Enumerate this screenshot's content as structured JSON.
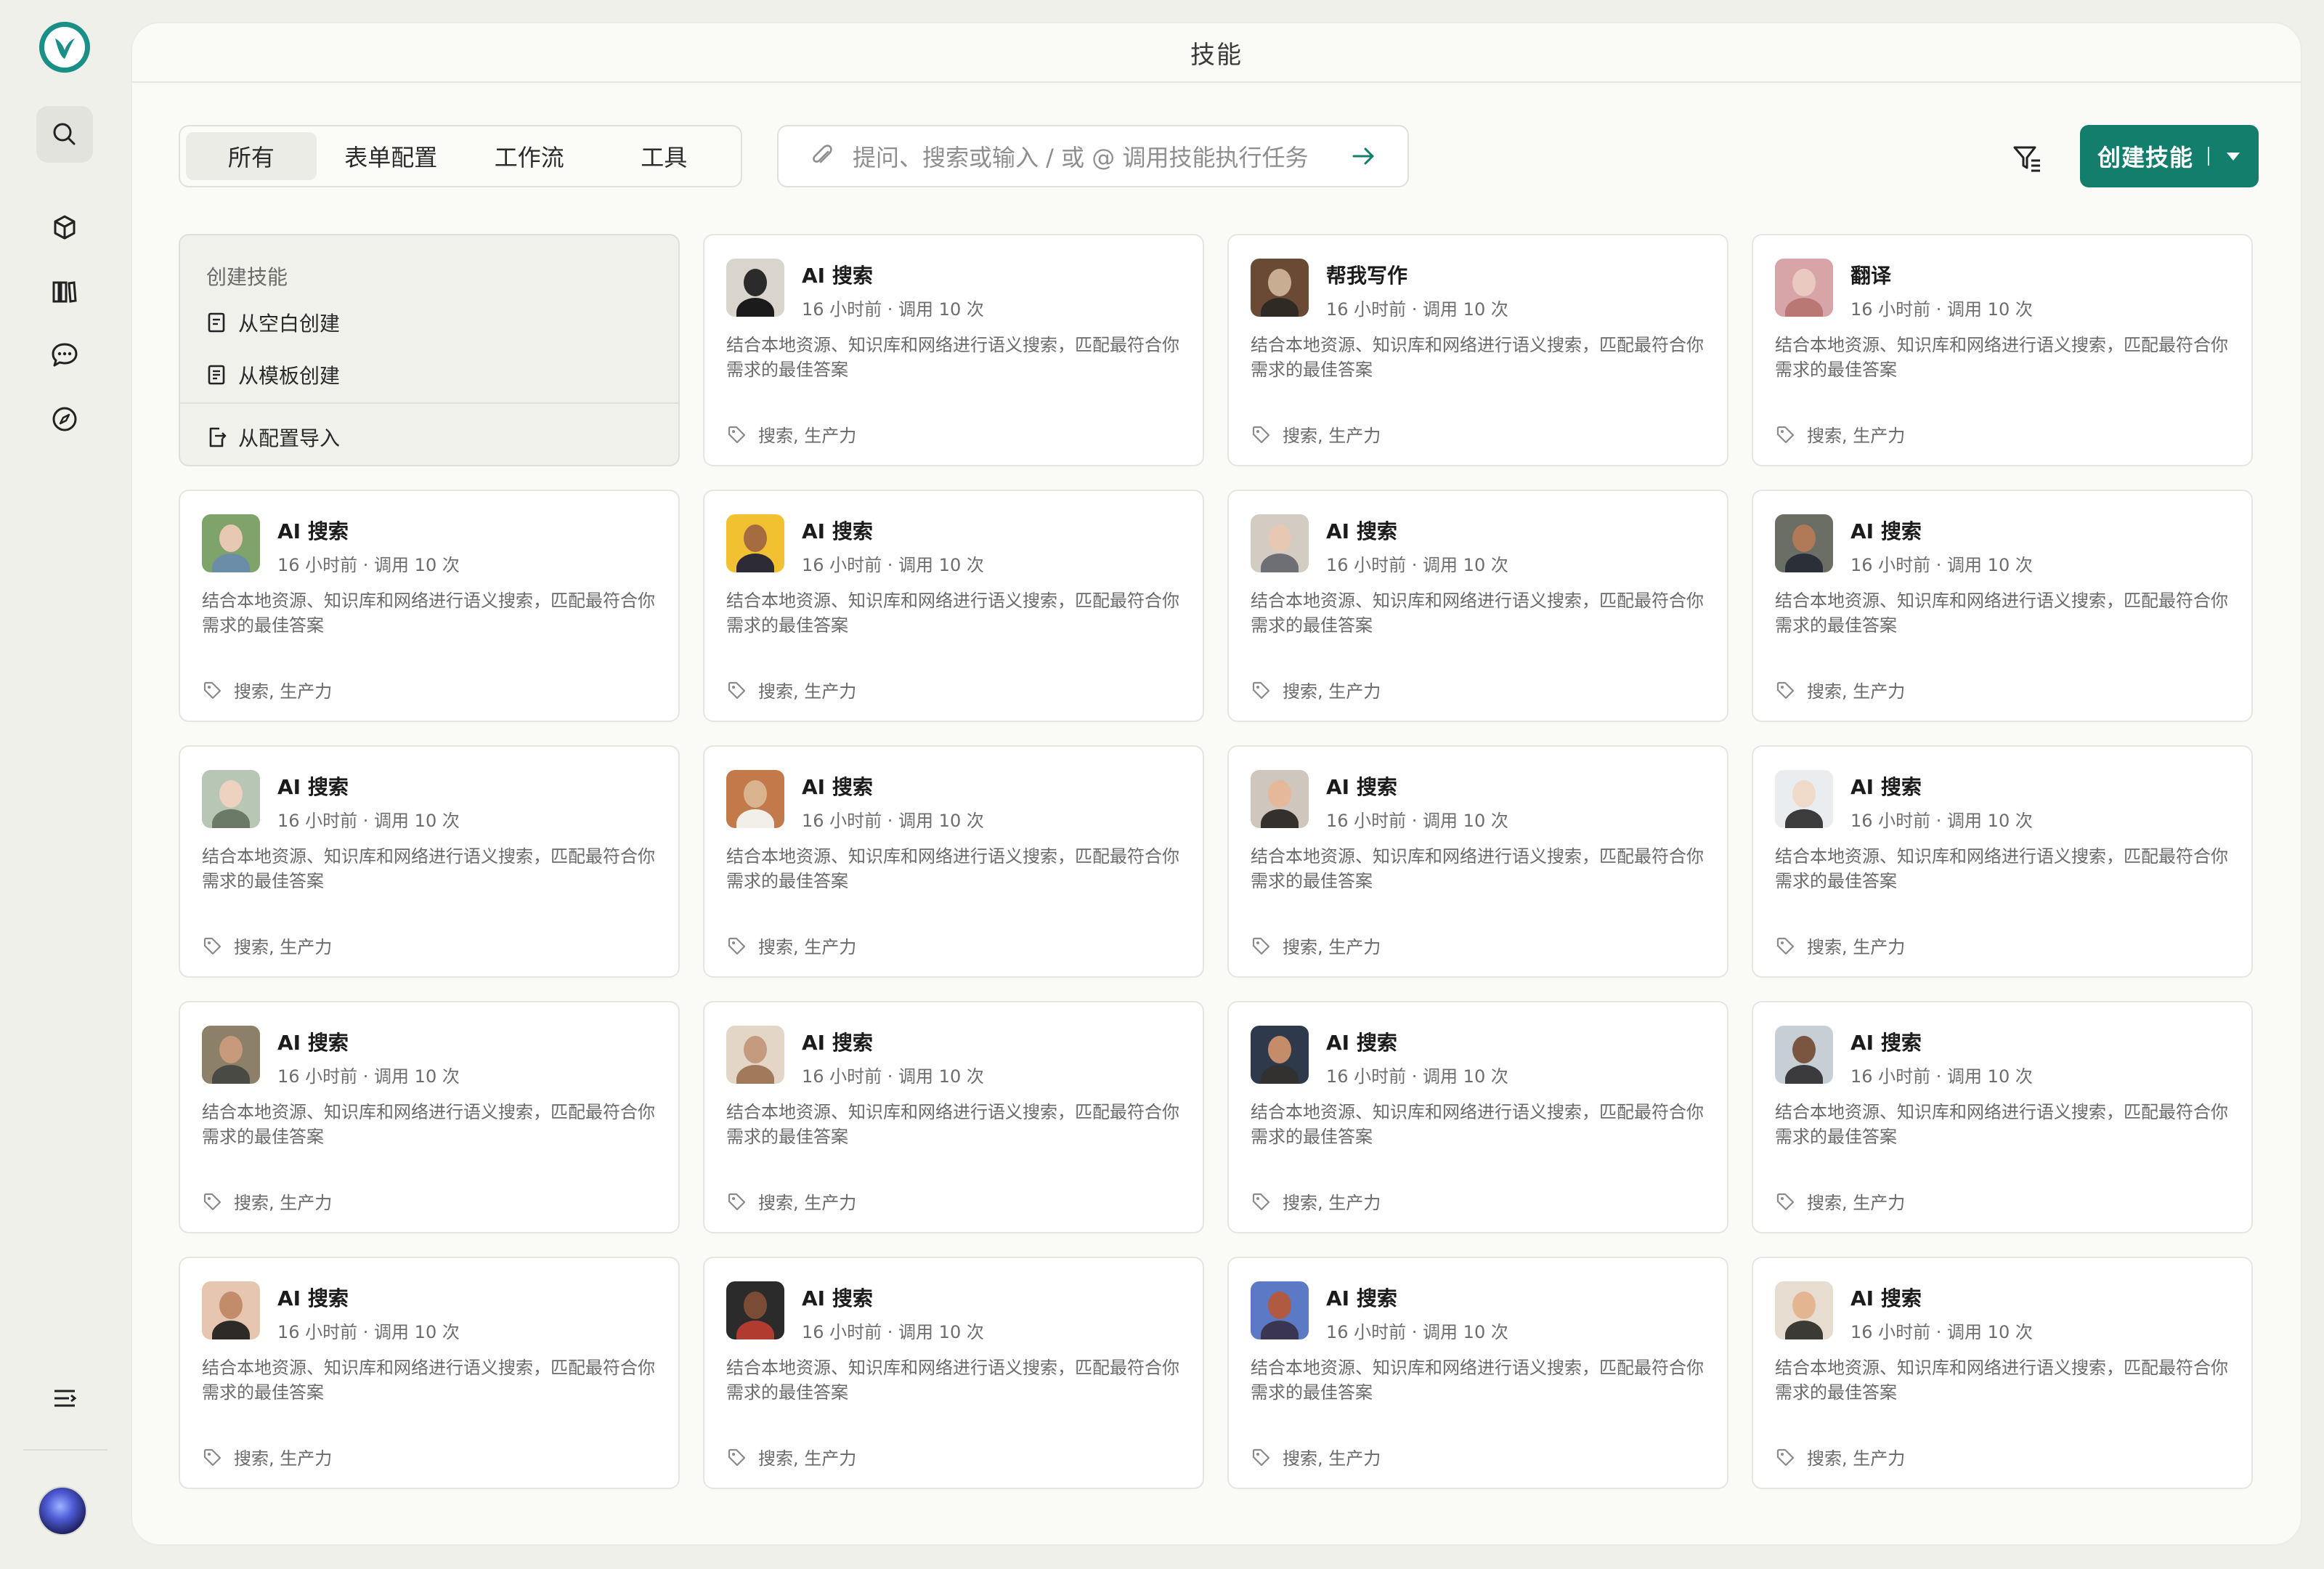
{
  "page": {
    "title": "技能"
  },
  "rail": {
    "logo": "leaf-logo",
    "items": [
      {
        "icon": "search-icon",
        "active": true
      },
      {
        "icon": "cube-icon"
      },
      {
        "icon": "library-icon"
      },
      {
        "icon": "chat-icon"
      },
      {
        "icon": "compass-icon"
      }
    ],
    "bottom": {
      "menu_icon": "menu-icon",
      "avatar": "user-avatar"
    }
  },
  "tabs": [
    "所有",
    "表单配置",
    "工作流",
    "工具"
  ],
  "active_tab": "所有",
  "search": {
    "placeholder": "提问、搜索或输入 / 或 @ 调用技能执行任务"
  },
  "toolbar": {
    "create_label": "创建技能"
  },
  "create_menu": {
    "header": "创建技能",
    "items": [
      "从空白创建",
      "从模板创建",
      "从配置导入"
    ]
  },
  "colors": {
    "accent": "#147e6c",
    "logo": "#1a8f86",
    "background": "#f0f0eb",
    "panel": "#fafaf6"
  },
  "skills": [
    {
      "name": "AI 搜索",
      "meta": "16 小时前 · 调用 10 次",
      "desc": "结合本地资源、知识库和网络进行语义搜索，匹配最符合你需求的最佳答案",
      "tags": "搜索, 生产力"
    },
    {
      "name": "帮我写作",
      "meta": "16 小时前 · 调用 10 次",
      "desc": "结合本地资源、知识库和网络进行语义搜索，匹配最符合你需求的最佳答案",
      "tags": "搜索, 生产力"
    },
    {
      "name": "翻译",
      "meta": "16 小时前 · 调用 10 次",
      "desc": "结合本地资源、知识库和网络进行语义搜索，匹配最符合你需求的最佳答案",
      "tags": "搜索, 生产力"
    },
    {
      "name": "AI 搜索",
      "meta": "16 小时前 · 调用 10 次",
      "desc": "结合本地资源、知识库和网络进行语义搜索，匹配最符合你需求的最佳答案",
      "tags": "搜索, 生产力"
    },
    {
      "name": "AI 搜索",
      "meta": "16 小时前 · 调用 10 次",
      "desc": "结合本地资源、知识库和网络进行语义搜索，匹配最符合你需求的最佳答案",
      "tags": "搜索, 生产力"
    },
    {
      "name": "AI 搜索",
      "meta": "16 小时前 · 调用 10 次",
      "desc": "结合本地资源、知识库和网络进行语义搜索，匹配最符合你需求的最佳答案",
      "tags": "搜索, 生产力"
    },
    {
      "name": "AI 搜索",
      "meta": "16 小时前 · 调用 10 次",
      "desc": "结合本地资源、知识库和网络进行语义搜索，匹配最符合你需求的最佳答案",
      "tags": "搜索, 生产力"
    },
    {
      "name": "AI 搜索",
      "meta": "16 小时前 · 调用 10 次",
      "desc": "结合本地资源、知识库和网络进行语义搜索，匹配最符合你需求的最佳答案",
      "tags": "搜索, 生产力"
    },
    {
      "name": "AI 搜索",
      "meta": "16 小时前 · 调用 10 次",
      "desc": "结合本地资源、知识库和网络进行语义搜索，匹配最符合你需求的最佳答案",
      "tags": "搜索, 生产力"
    },
    {
      "name": "AI 搜索",
      "meta": "16 小时前 · 调用 10 次",
      "desc": "结合本地资源、知识库和网络进行语义搜索，匹配最符合你需求的最佳答案",
      "tags": "搜索, 生产力"
    },
    {
      "name": "AI 搜索",
      "meta": "16 小时前 · 调用 10 次",
      "desc": "结合本地资源、知识库和网络进行语义搜索，匹配最符合你需求的最佳答案",
      "tags": "搜索, 生产力"
    },
    {
      "name": "AI 搜索",
      "meta": "16 小时前 · 调用 10 次",
      "desc": "结合本地资源、知识库和网络进行语义搜索，匹配最符合你需求的最佳答案",
      "tags": "搜索, 生产力"
    },
    {
      "name": "AI 搜索",
      "meta": "16 小时前 · 调用 10 次",
      "desc": "结合本地资源、知识库和网络进行语义搜索，匹配最符合你需求的最佳答案",
      "tags": "搜索, 生产力"
    },
    {
      "name": "AI 搜索",
      "meta": "16 小时前 · 调用 10 次",
      "desc": "结合本地资源、知识库和网络进行语义搜索，匹配最符合你需求的最佳答案",
      "tags": "搜索, 生产力"
    },
    {
      "name": "AI 搜索",
      "meta": "16 小时前 · 调用 10 次",
      "desc": "结合本地资源、知识库和网络进行语义搜索，匹配最符合你需求的最佳答案",
      "tags": "搜索, 生产力"
    },
    {
      "name": "AI 搜索",
      "meta": "16 小时前 · 调用 10 次",
      "desc": "结合本地资源、知识库和网络进行语义搜索，匹配最符合你需求的最佳答案",
      "tags": "搜索, 生产力"
    },
    {
      "name": "AI 搜索",
      "meta": "16 小时前 · 调用 10 次",
      "desc": "结合本地资源、知识库和网络进行语义搜索，匹配最符合你需求的最佳答案",
      "tags": "搜索, 生产力"
    },
    {
      "name": "AI 搜索",
      "meta": "16 小时前 · 调用 10 次",
      "desc": "结合本地资源、知识库和网络进行语义搜索，匹配最符合你需求的最佳答案",
      "tags": "搜索, 生产力"
    },
    {
      "name": "AI 搜索",
      "meta": "16 小时前 · 调用 10 次",
      "desc": "结合本地资源、知识库和网络进行语义搜索，匹配最符合你需求的最佳答案",
      "tags": "搜索, 生产力"
    }
  ]
}
